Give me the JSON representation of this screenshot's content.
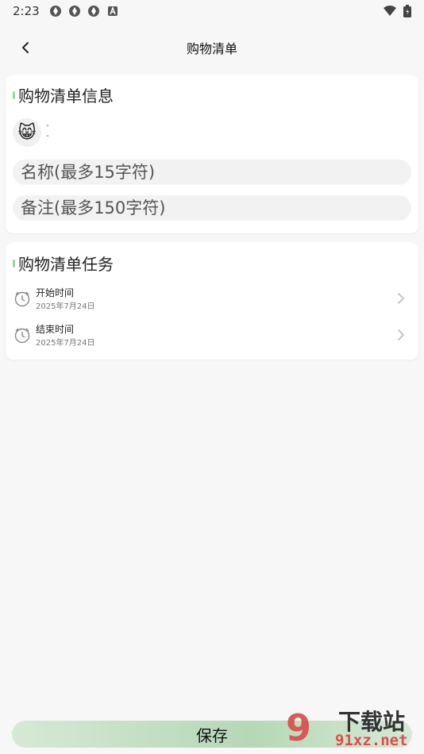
{
  "status_bar": {
    "time": "2:23",
    "left_icons": [
      "app-icon",
      "app-icon",
      "app-icon",
      "accessibility-icon"
    ],
    "right_icons": [
      "wifi-icon",
      "battery-icon"
    ]
  },
  "header": {
    "title": "购物清单",
    "back_icon": "chevron-left-icon"
  },
  "info_section": {
    "title": "购物清单信息",
    "avatar": "😸",
    "avatar_line1": "-",
    "avatar_line2": "-",
    "name_placeholder": "名称(最多15字符)",
    "note_placeholder": "备注(最多150字符)"
  },
  "task_section": {
    "title": "购物清单任务",
    "rows": [
      {
        "label": "开始时间",
        "date": "2025年7月24日",
        "icon": "clock-icon"
      },
      {
        "label": "结束时间",
        "date": "2025年7月24日",
        "icon": "clock-icon"
      }
    ]
  },
  "footer": {
    "save_label": "保存"
  },
  "watermark": {
    "big": "9",
    "cn": "下载站",
    "url": "91xz.net"
  },
  "colors": {
    "accent_bar": "#9fd1a8",
    "save_button": "#b5d8b5",
    "watermark_red": "#d94b4b"
  }
}
